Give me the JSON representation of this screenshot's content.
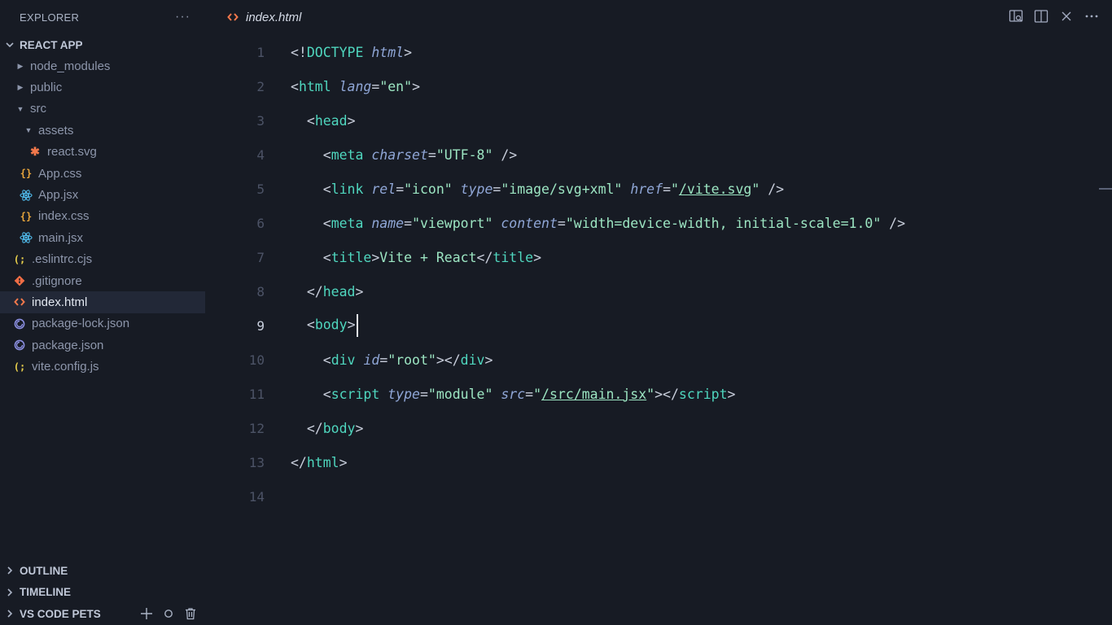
{
  "sidebar": {
    "title": "EXPLORER",
    "more_icon": "ellipsis-icon",
    "project": "REACT APP",
    "tree": [
      {
        "label": "node_modules",
        "kind": "folder",
        "depth": 0,
        "expanded": false
      },
      {
        "label": "public",
        "kind": "folder",
        "depth": 0,
        "expanded": false
      },
      {
        "label": "src",
        "kind": "folder",
        "depth": 0,
        "expanded": true
      },
      {
        "label": "assets",
        "kind": "folder",
        "depth": 1,
        "expanded": true
      },
      {
        "label": "react.svg",
        "kind": "svg",
        "depth": 2
      },
      {
        "label": "App.css",
        "kind": "css",
        "depth": 1
      },
      {
        "label": "App.jsx",
        "kind": "react",
        "depth": 1
      },
      {
        "label": "index.css",
        "kind": "css",
        "depth": 1
      },
      {
        "label": "main.jsx",
        "kind": "react",
        "depth": 1
      },
      {
        "label": ".eslintrc.cjs",
        "kind": "js",
        "depth": 0
      },
      {
        "label": ".gitignore",
        "kind": "git",
        "depth": 0
      },
      {
        "label": "index.html",
        "kind": "html",
        "depth": 0,
        "active": true
      },
      {
        "label": "package-lock.json",
        "kind": "npm",
        "depth": 0
      },
      {
        "label": "package.json",
        "kind": "npm",
        "depth": 0
      },
      {
        "label": "vite.config.js",
        "kind": "js",
        "depth": 0
      }
    ],
    "sections": [
      "OUTLINE",
      "TIMELINE",
      "VS CODE PETS"
    ]
  },
  "tab": {
    "label": "index.html"
  },
  "colors": {
    "html": "#f2784b",
    "css": "#e8a53c",
    "react": "#4fb8e8",
    "js": "#e8cf4c",
    "git": "#f06d45",
    "npm": "#8b8fe0",
    "svg": "#f2784b"
  },
  "editor": {
    "current_line": 9,
    "line_numbers": [
      "1",
      "2",
      "3",
      "4",
      "5",
      "6",
      "7",
      "8",
      "9",
      "10",
      "11",
      "12",
      "13",
      "14"
    ],
    "l1": {
      "a": "<!",
      "b": "DOCTYPE",
      "c": " ",
      "d": "html",
      "e": ">"
    },
    "l2": {
      "a": "<",
      "b": "html",
      "c": "lang",
      "d": "=",
      "e": "\"en\"",
      "f": ">"
    },
    "l3": {
      "a": "<",
      "b": "head",
      "c": ">"
    },
    "l4": {
      "a": "<",
      "b": "meta",
      "c": "charset",
      "d": "=",
      "e": "\"UTF-8\"",
      "f": " />"
    },
    "l5": {
      "a": "<",
      "b": "link",
      "c": "rel",
      "d": "=",
      "e": "\"icon\"",
      "f": "type",
      "g": "=",
      "h": "\"image/svg+xml\"",
      "i": "href",
      "j": "=",
      "k": "\"",
      "l": "/vite.svg",
      "m": "\"",
      "n": " />"
    },
    "l6": {
      "a": "<",
      "b": "meta",
      "c": "name",
      "d": "=",
      "e": "\"viewport\"",
      "f": "content",
      "g": "=",
      "h": "\"width=device-width, initial-scale=1.0\"",
      "i": " />"
    },
    "l7": {
      "a": "<",
      "b": "title",
      "c": ">",
      "d": "Vite + React",
      "e": "</",
      "f": "title",
      "g": ">"
    },
    "l8": {
      "a": "</",
      "b": "head",
      "c": ">"
    },
    "l9": {
      "a": "<",
      "b": "body",
      "c": ">"
    },
    "l10": {
      "a": "<",
      "b": "div",
      "c": "id",
      "d": "=",
      "e": "\"root\"",
      "f": "></",
      "g": "div",
      "h": ">"
    },
    "l11": {
      "a": "<",
      "b": "script",
      "c": "type",
      "d": "=",
      "e": "\"module\"",
      "f": "src",
      "g": "=",
      "h": "\"",
      "i": "/src/main.jsx",
      "j": "\"",
      "k": "></",
      "l": "script",
      "m": ">"
    },
    "l12": {
      "a": "</",
      "b": "body",
      "c": ">"
    },
    "l13": {
      "a": "</",
      "b": "html",
      "c": ">"
    }
  }
}
